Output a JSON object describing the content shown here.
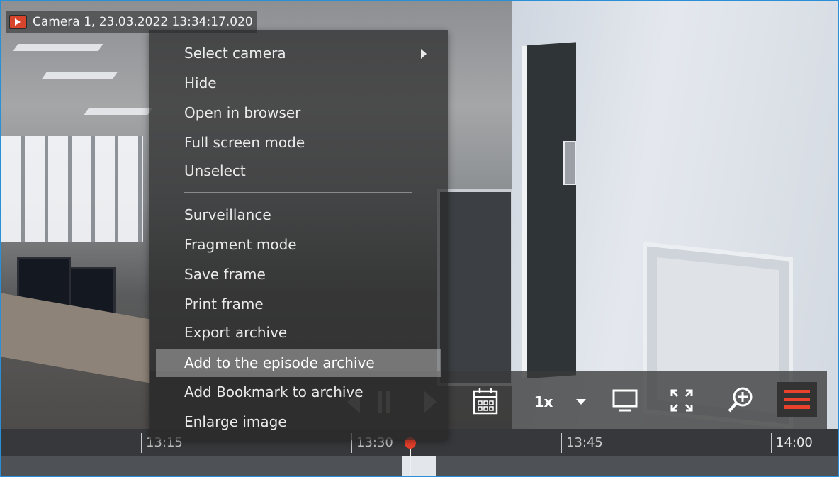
{
  "window": {
    "title": "Camera 1, 23.03.2022 13:34:17.020",
    "accent_color": "#2a8fd6"
  },
  "context_menu": {
    "groups": [
      [
        "Select camera",
        "Hide",
        "Open in browser",
        "Full screen mode",
        "Unselect"
      ],
      [
        "Surveillance",
        "Fragment mode",
        "Save frame",
        "Print frame",
        "Export archive",
        "Add to the episode archive",
        "Add Bookmark to archive",
        "Enlarge image"
      ]
    ],
    "highlighted_item": "Add to the episode archive",
    "submenu_item": "Select camera"
  },
  "controls": {
    "speed_label": "1x",
    "icons": [
      "prev-frame-icon",
      "pause-icon",
      "next-frame-icon",
      "calendar-icon",
      "chevron-down-icon",
      "monitor-icon",
      "fullscreen-icon",
      "zoom-in-icon",
      "hamburger-menu-icon"
    ],
    "menu_button_color": "#e8412c"
  },
  "timeline": {
    "ticks": [
      "13:15",
      "13:30",
      "13:45",
      "14:00"
    ],
    "playhead_color": "#e8412c"
  }
}
